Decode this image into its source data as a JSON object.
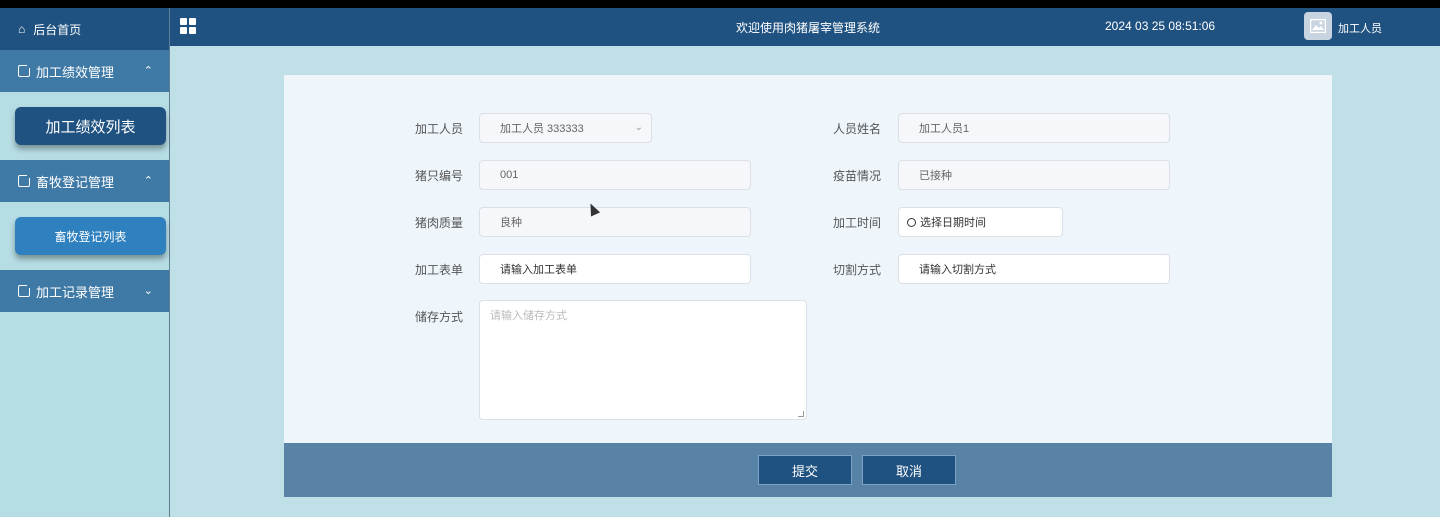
{
  "sidebar": {
    "home": "后台首页",
    "groups": [
      {
        "label": "加工绩效管理",
        "chevron": "^",
        "sub": "加工绩效列表"
      },
      {
        "label": "畜牧登记管理",
        "chevron": "^",
        "sub": "畜牧登记列表"
      },
      {
        "label": "加工记录管理",
        "chevron": "v"
      }
    ]
  },
  "header": {
    "title": "欢迎使用肉猪屠宰管理系统",
    "datetime": "2024 03 25 08:51:06",
    "user": "加工人员"
  },
  "form": {
    "worker_label": "加工人员",
    "worker_value": "加工人员 333333",
    "name_label": "人员姓名",
    "name_value": "加工人员1",
    "pig_no_label": "猪只编号",
    "pig_no_value": "001",
    "vaccine_label": "疫苗情况",
    "vaccine_value": "已接种",
    "quality_label": "猪肉质量",
    "quality_value": "良种",
    "time_label": "加工时间",
    "time_placeholder": "选择日期时间",
    "order_label": "加工表单",
    "order_placeholder": "请输入加工表单",
    "cut_label": "切割方式",
    "cut_placeholder": "请输入切割方式",
    "storage_label": "储存方式",
    "storage_placeholder": "请输入储存方式"
  },
  "actions": {
    "submit": "提交",
    "cancel": "取消"
  }
}
